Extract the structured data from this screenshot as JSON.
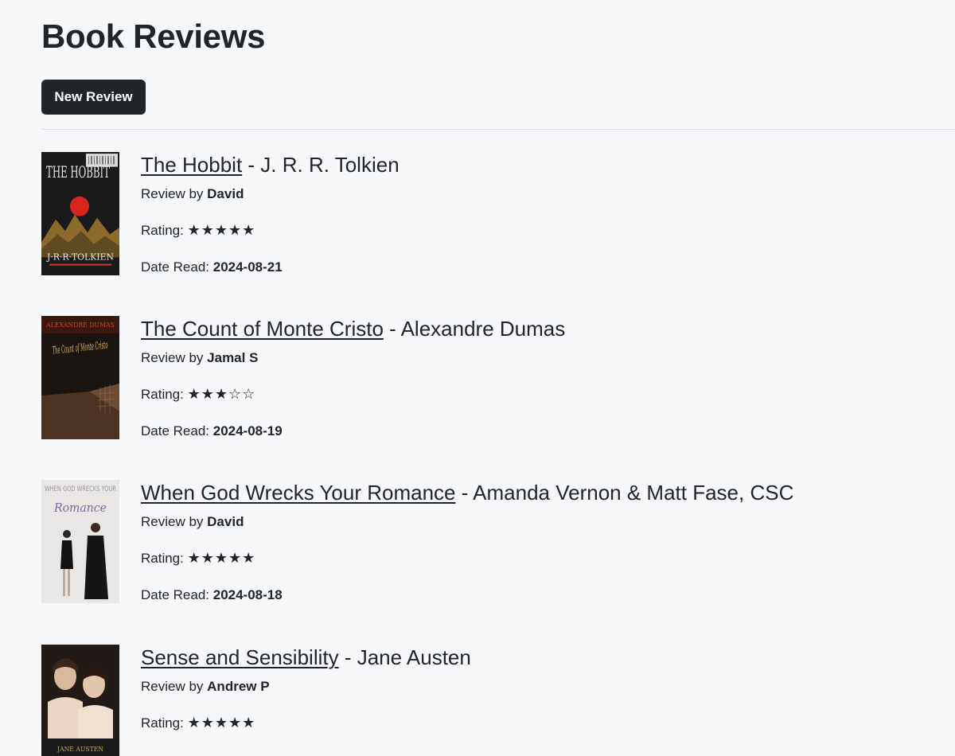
{
  "page": {
    "title": "Book Reviews",
    "new_review_label": "New Review",
    "labels": {
      "review_by": "Review by",
      "rating": "Rating:",
      "date_read": "Date Read:",
      "separator": " - "
    }
  },
  "reviews": [
    {
      "title": "The Hobbit",
      "author": "J. R. R. Tolkien",
      "reviewer": "David",
      "rating_text": "★★★★★",
      "rating": 5,
      "date_read": "2024-08-21",
      "cover_text_top": "THE HOBBIT",
      "cover_text_bottom": "J·R·R·TOLKIEN"
    },
    {
      "title": "The Count of Monte Cristo",
      "author": "Alexandre Dumas",
      "reviewer": "Jamal S",
      "rating_text": "★★★☆☆",
      "rating": 3,
      "date_read": "2024-08-19",
      "cover_text_top": "ALEXANDRE DUMAS",
      "cover_text_title": "The Count of Monte Cristo"
    },
    {
      "title": "When God Wrecks Your Romance",
      "author": "Amanda Vernon & Matt Fase, CSC",
      "reviewer": "David",
      "rating_text": "★★★★★",
      "rating": 5,
      "date_read": "2024-08-18",
      "cover_text_top": "WHEN GOD WRECKS YOUR",
      "cover_text_title": "Romance"
    },
    {
      "title": "Sense and Sensibility",
      "author": "Jane Austen",
      "reviewer": "Andrew P",
      "rating_text": "★★★★★",
      "rating": 5,
      "cover_text_bottom": "JANE AUSTEN"
    }
  ],
  "colors": {
    "background": "#f7f8fa",
    "text": "#212529",
    "button_bg": "#212529",
    "button_text": "#ffffff",
    "divider": "#dfe2e6"
  }
}
